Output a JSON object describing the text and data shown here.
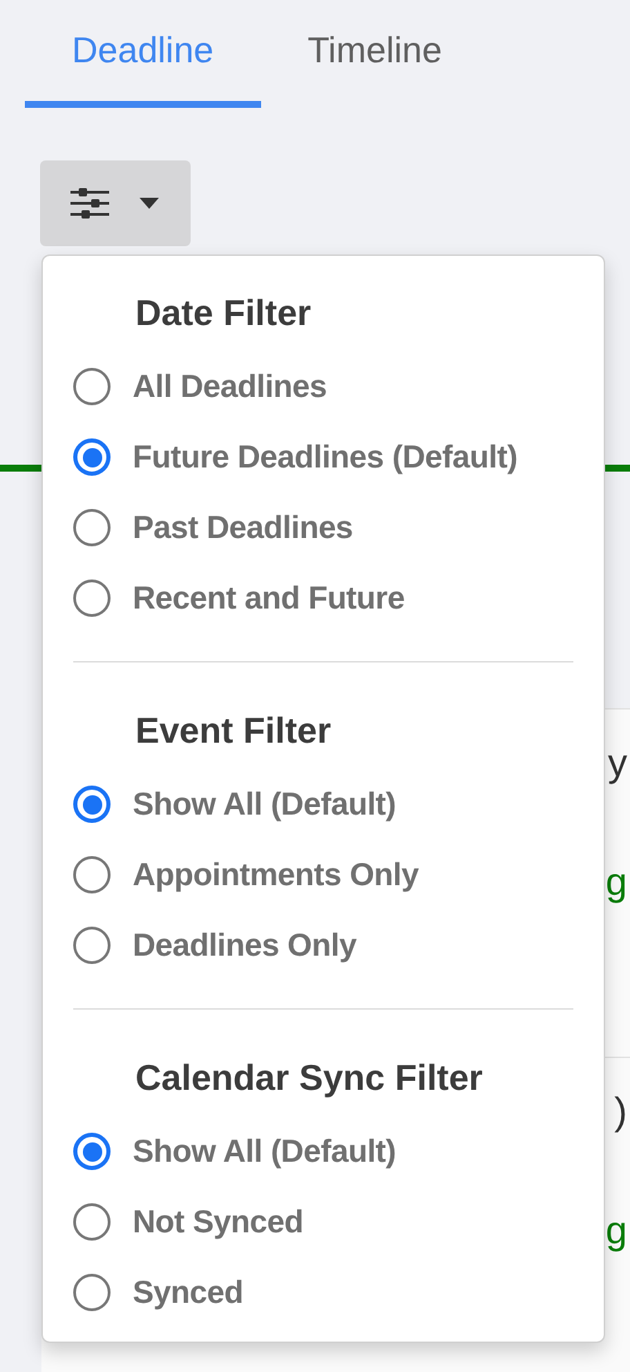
{
  "tabs": [
    {
      "label": "Deadline",
      "selected": true
    },
    {
      "label": "Timeline",
      "selected": false
    }
  ],
  "filter_menu": {
    "open": true,
    "sections": [
      {
        "title": "Date Filter",
        "options": [
          {
            "label": "All Deadlines",
            "selected": false
          },
          {
            "label": "Future Deadlines (Default)",
            "selected": true
          },
          {
            "label": "Past Deadlines",
            "selected": false
          },
          {
            "label": "Recent and Future",
            "selected": false
          }
        ]
      },
      {
        "title": "Event Filter",
        "options": [
          {
            "label": "Show All (Default)",
            "selected": true
          },
          {
            "label": "Appointments Only",
            "selected": false
          },
          {
            "label": "Deadlines Only",
            "selected": false
          }
        ]
      },
      {
        "title": "Calendar Sync Filter",
        "options": [
          {
            "label": "Show All (Default)",
            "selected": true
          },
          {
            "label": "Not Synced",
            "selected": false
          },
          {
            "label": "Synced",
            "selected": false
          }
        ]
      }
    ]
  },
  "cards": [
    {
      "title": "y",
      "status": "g"
    },
    {
      "title": ")",
      "status": "g"
    }
  ]
}
